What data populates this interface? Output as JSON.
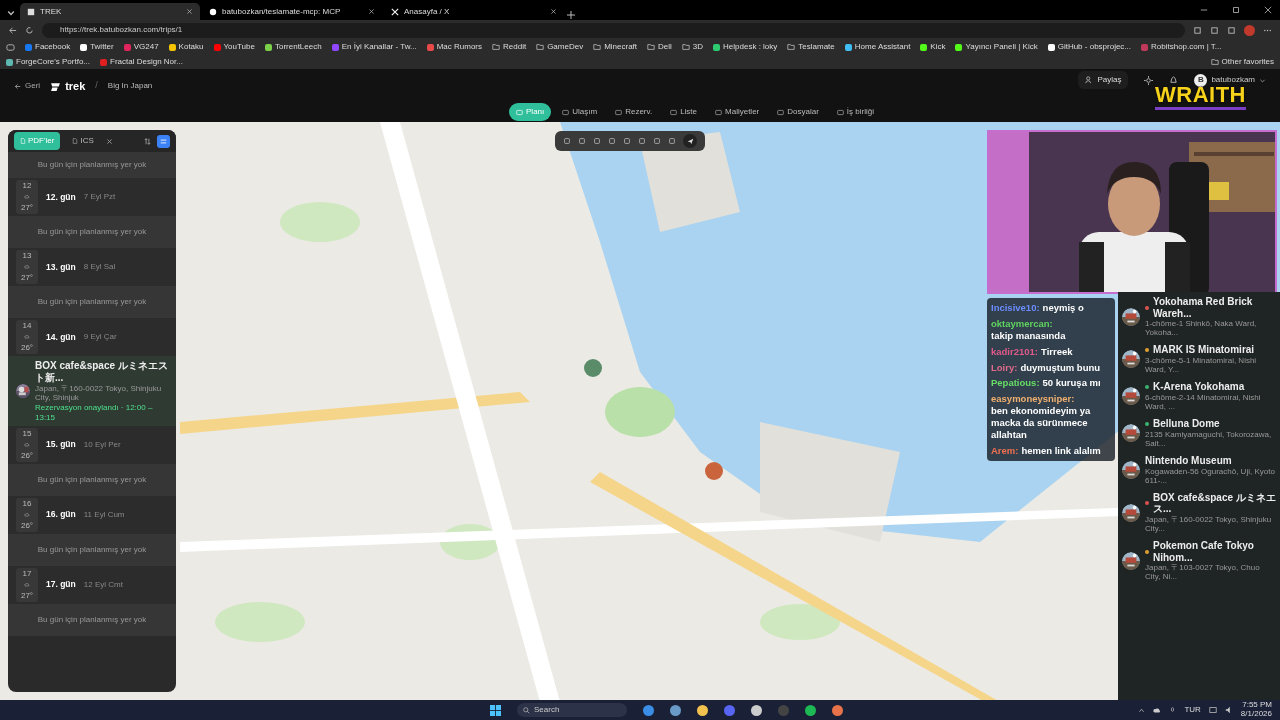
{
  "browser": {
    "tabs": [
      {
        "title": "TREK",
        "kind": "app",
        "selected": true
      },
      {
        "title": "batubozkan/teslamate-mcp: MCP",
        "kind": "github",
        "selected": false
      },
      {
        "title": "Anasayfa / X",
        "kind": "x",
        "selected": false
      }
    ],
    "url": "https://trek.batubozkan.com/trips/1",
    "bookmarks": [
      {
        "label": "Facebook",
        "kind": "site",
        "color": "#1877f2"
      },
      {
        "label": "Twitter",
        "kind": "site",
        "color": "#ffffff"
      },
      {
        "label": "VG247",
        "kind": "site",
        "color": "#e0245e"
      },
      {
        "label": "Kotaku",
        "kind": "site",
        "color": "#f5c400"
      },
      {
        "label": "YouTube",
        "kind": "site",
        "color": "#ff0000"
      },
      {
        "label": "TorrentLeech",
        "kind": "site",
        "color": "#7bd14a"
      },
      {
        "label": "En İyi Kanallar - Tw...",
        "kind": "site",
        "color": "#9146ff"
      },
      {
        "label": "Mac Rumors",
        "kind": "site",
        "color": "#e84a4a"
      },
      {
        "label": "Reddit",
        "kind": "folder"
      },
      {
        "label": "GameDev",
        "kind": "folder"
      },
      {
        "label": "Minecraft",
        "kind": "folder"
      },
      {
        "label": "Dell",
        "kind": "folder"
      },
      {
        "label": "3D",
        "kind": "folder"
      },
      {
        "label": "Helpdesk : loky",
        "kind": "site",
        "color": "#2ecc71"
      },
      {
        "label": "Teslamate",
        "kind": "folder"
      },
      {
        "label": "Home Assistant",
        "kind": "site",
        "color": "#41bdf5"
      },
      {
        "label": "Kick",
        "kind": "site",
        "color": "#53fc18"
      },
      {
        "label": "Yayıncı Paneli | Kick",
        "kind": "site",
        "color": "#53fc18"
      },
      {
        "label": "GitHub - obsprojec...",
        "kind": "site",
        "color": "#ffffff"
      },
      {
        "label": "Robitshop.com | T...",
        "kind": "site",
        "color": "#c0395a"
      },
      {
        "label": "ForgeCore's Portfo...",
        "kind": "site",
        "color": "#5fb8b0"
      },
      {
        "label": "Fractal Design Nor...",
        "kind": "site",
        "color": "#e02020"
      }
    ],
    "other_favorites": "Other favorites"
  },
  "app": {
    "back": "Geri",
    "brand": "trek",
    "separator": "/",
    "trip": "Big In Japan",
    "share": "Paylaş",
    "user_initial": "B",
    "user": "batubozkam",
    "nav": [
      {
        "label": "Planı",
        "selected": true
      },
      {
        "label": "Ulaşım",
        "selected": false
      },
      {
        "label": "Rezerv.",
        "selected": false
      },
      {
        "label": "Liste",
        "selected": false
      },
      {
        "label": "Maliyetler",
        "selected": false
      },
      {
        "label": "Dosyalar",
        "selected": false
      },
      {
        "label": "İş birliği",
        "selected": false
      }
    ]
  },
  "overlay_logo": "WRAITH",
  "day_panel": {
    "buttons": [
      {
        "label": "PDF'ler",
        "selected": true
      },
      {
        "label": "ICS",
        "selected": false
      }
    ],
    "top_empty": "Bu gün için planlanmış yer yok",
    "days": [
      {
        "number": "12",
        "temp": "27°",
        "title": "12. gün",
        "date": "7 Eyl Pzt",
        "empty": "Bu gün için planlanmış yer yok"
      },
      {
        "number": "13",
        "temp": "27°",
        "title": "13. gün",
        "date": "8 Eyl Sal",
        "empty": "Bu gün için planlanmış yer yok"
      },
      {
        "number": "14",
        "temp": "26°",
        "title": "14. gün",
        "date": "9 Eyl Çar",
        "places": [
          {
            "name": "BOX cafe&space ルミネエスト新...",
            "address": "Japan, 〒160-0022 Tokyo, Shinjuku City, Shinjuk",
            "status": "Rezervasyon onaylandı · 12:00 – 13:15"
          }
        ]
      },
      {
        "number": "15",
        "temp": "26°",
        "title": "15. gün",
        "date": "10 Eyl Per",
        "empty": "Bu gün için planlanmış yer yok"
      },
      {
        "number": "16",
        "temp": "26°",
        "title": "16. gün",
        "date": "11 Eyl Cum",
        "empty": "Bu gün için planlanmış yer yok"
      },
      {
        "number": "17",
        "temp": "27°",
        "title": "17. gün",
        "date": "12 Eyl Cmt",
        "empty": "Bu gün için planlanmış yer yok"
      }
    ]
  },
  "chat": [
    {
      "user": "Incisive10:",
      "color": "#6b8cff",
      "message": "neymiş o"
    },
    {
      "user": "oktaymercan:",
      "color": "#5fd35f",
      "message": "takip manasında"
    },
    {
      "user": "kadir2101:",
      "color": "#e05a8a",
      "message": "Tirreek"
    },
    {
      "user": "Loiry:",
      "color": "#e06a8a",
      "message": "duymuştum bunu"
    },
    {
      "user": "Pepatious:",
      "color": "#66dd66",
      "message": "50 kuruşa mı"
    },
    {
      "user": "easymoneysniper:",
      "color": "#f0b070",
      "message": "ben ekonomideyim ya macka da sürünmece allahtan"
    },
    {
      "user": "Arem:",
      "color": "#f07050",
      "message": "hemen link alalım"
    }
  ],
  "places": [
    {
      "name": "Yokohama Red Brick Wareh...",
      "address": "1-chōme-1 Shinkō, Naka Ward, Yokoha...",
      "color": "#d9534f"
    },
    {
      "name": "MARK IS Minatomirai",
      "address": "3-chōme-5-1 Minatomirai, Nishi Ward, Y...",
      "color": "#e0a030"
    },
    {
      "name": "K-Arena Yokohama",
      "address": "6-chōme-2-14 Minatomirai, Nishi Ward, ...",
      "color": "#3cb371"
    },
    {
      "name": "Belluna Dome",
      "address": "2135 Kamiyamaguchi, Tokorozawa, Sait...",
      "color": "#3cb371"
    },
    {
      "name": "Nintendo Museum",
      "address": "Kogawaden-56 Ogurachō, Uji, Kyoto 611-..."
    },
    {
      "name": "BOX cafe&space ルミネエス...",
      "address": "Japan, 〒160-0022 Tokyo, Shinjuku City...",
      "color": "#d9534f"
    },
    {
      "name": "Pokemon Cafe Tokyo Nihom...",
      "address": "Japan, 〒103-0027 Tokyo, Chuo City, Ni...",
      "color": "#e0a030"
    }
  ],
  "taskbar": {
    "search": "Search",
    "language": "TUR",
    "time": "7:55 PM",
    "date": "8/1/2026"
  }
}
